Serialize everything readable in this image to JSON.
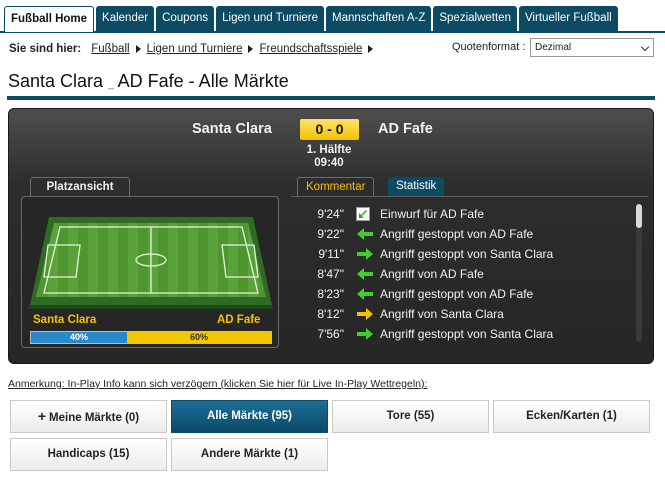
{
  "tabs": [
    "Fußball Home",
    "Kalender",
    "Coupons",
    "Ligen und Turniere",
    "Mannschaften A-Z",
    "Spezialwetten",
    "Virtueller Fußball"
  ],
  "breadcrumb": {
    "label": "Sie sind hier:",
    "items": [
      "Fußball",
      "Ligen und Turniere",
      "Freundschaftsspiele"
    ]
  },
  "quote_format": {
    "label": "Quotenformat :",
    "value": "Dezimal"
  },
  "page_title": {
    "home": "Santa Clara",
    "sep": "_",
    "rest": "AD Fafe - Alle Märkte"
  },
  "match": {
    "home": "Santa Clara",
    "away": "AD Fafe",
    "score": "0 - 0",
    "period": "1. Hälfte",
    "clock": "09:40"
  },
  "pitch": {
    "tab_label": "Platzansicht",
    "home_label": "Santa Clara",
    "away_label": "AD Fafe",
    "home_possession": 40,
    "away_possession": 60,
    "home_possession_text": "40%",
    "away_possession_text": "60%"
  },
  "commentary": {
    "tabs": [
      "Kommentar",
      "Statistik"
    ],
    "events": [
      {
        "time": "9'24\"",
        "text": "Einwurf für AD Fafe",
        "icon": "throw-in-icon"
      },
      {
        "time": "9'22\"",
        "text": "Angriff gestoppt von AD Fafe",
        "icon": "arrow-left-green-icon"
      },
      {
        "time": "9'11\"",
        "text": "Angriff gestoppt von Santa Clara",
        "icon": "arrow-right-green-icon"
      },
      {
        "time": "8'47\"",
        "text": "Angriff von AD Fafe",
        "icon": "arrow-left-green-icon"
      },
      {
        "time": "8'23\"",
        "text": "Angriff gestoppt von AD Fafe",
        "icon": "arrow-left-green-icon"
      },
      {
        "time": "8'12\"",
        "text": "Angriff von Santa Clara",
        "icon": "arrow-right-yellow-icon"
      },
      {
        "time": "7'56\"",
        "text": "Angriff gestoppt von Santa Clara",
        "icon": "arrow-right-green-icon"
      }
    ]
  },
  "note": "Anmerkung: In-Play Info kann sich verzögern (klicken Sie hier für Live In-Play Wettregeln):",
  "markets": [
    {
      "label": "Meine Märkte (0)",
      "plus": "+"
    },
    {
      "label": "Alle Märkte (95)"
    },
    {
      "label": "Tore (55)"
    },
    {
      "label": "Ecken/Karten (1)"
    },
    {
      "label": "Handicaps (15)"
    },
    {
      "label": "Andere Märkte (1)"
    }
  ],
  "colors": {
    "brand": "#0d4a63",
    "accent": "#f2c200",
    "home": "#2a89c9",
    "away": "#f2c800",
    "active_button": "#0b4a68"
  }
}
